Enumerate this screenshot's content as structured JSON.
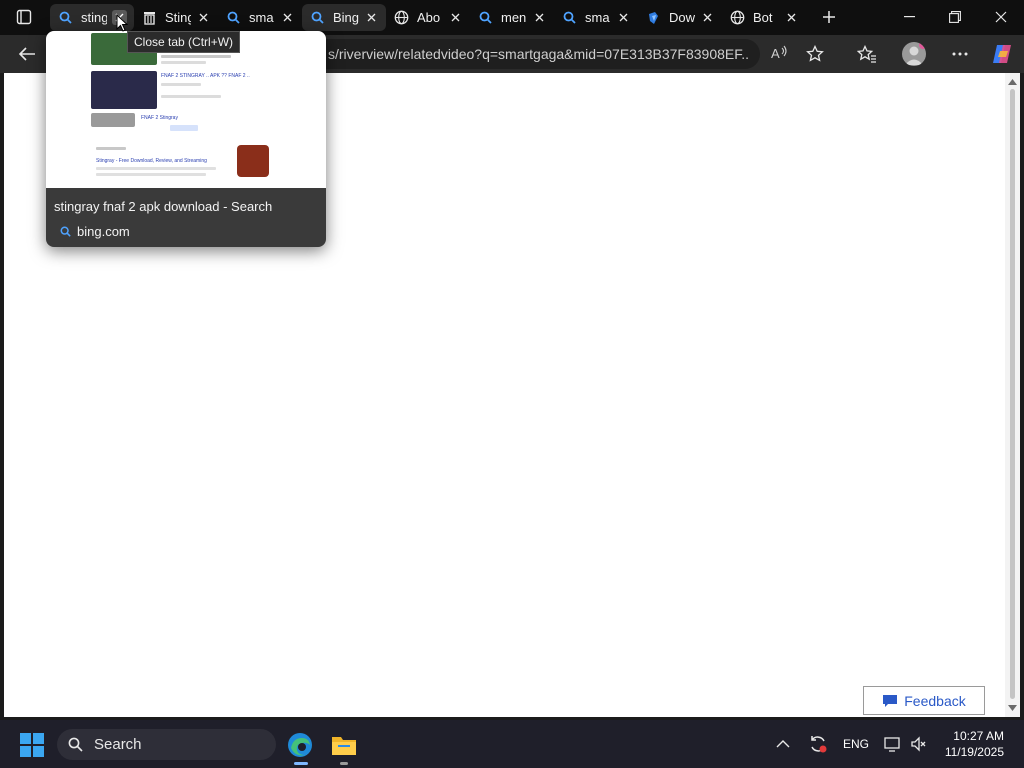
{
  "tabs": [
    {
      "label": "sting",
      "icon": "search-icon"
    },
    {
      "label": "Sting",
      "icon": "trash-bin-icon"
    },
    {
      "label": "sma",
      "icon": "search-icon"
    },
    {
      "label": "Bing",
      "icon": "search-icon"
    },
    {
      "label": "Abo",
      "icon": "globe-icon"
    },
    {
      "label": "men",
      "icon": "search-icon"
    },
    {
      "label": "sma",
      "icon": "search-icon"
    },
    {
      "label": "Dow",
      "icon": "edge-store-icon"
    },
    {
      "label": "Bot",
      "icon": "globe-icon"
    }
  ],
  "tooltip": "Close tab (Ctrl+W)",
  "address": {
    "url": "s/riverview/relatedvideo?q=smartgaga&mid=07E313B37F83908EF..."
  },
  "hover_card": {
    "title": "stingray fnaf 2 apk download - Search",
    "domain": "bing.com",
    "thumb": {
      "line1": "FNAF 2 STINGRAY .. APK ?? FNAF 2 ..",
      "line2": "FNAF 2 Stingray",
      "line3": "Stingray - Free Download, Review, and Streaming"
    }
  },
  "page": {
    "feedback_label": "Feedback"
  },
  "taskbar": {
    "search_label": "Search",
    "language": "ENG",
    "time": "10:27 AM",
    "date": "11/19/2025"
  },
  "colors": {
    "tab_strip": "#0f0f0f",
    "toolbar": "#2b2b2b",
    "accent_blue": "#2a59c7",
    "taskbar": "#1f1f2a"
  }
}
